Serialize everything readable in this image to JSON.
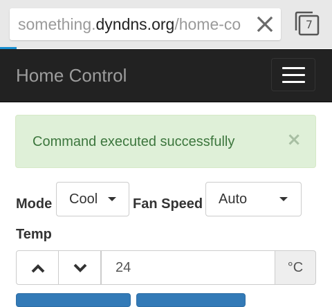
{
  "browser": {
    "url_prefix": "something.",
    "url_domain": "dyndns.org",
    "url_path": "/home-co",
    "clear_icon": "close-icon",
    "tabs_count": "7"
  },
  "navbar": {
    "brand": "Home Control",
    "menu_icon": "hamburger-icon"
  },
  "alert": {
    "message": "Command executed successfully",
    "close": "×"
  },
  "form": {
    "mode_label": "Mode",
    "mode_value": "Cool",
    "fan_label": "Fan Speed",
    "fan_value": "Auto",
    "temp_label": "Temp",
    "temp_value": "24",
    "temp_unit": "°C",
    "up_icon": "chevron-up-icon",
    "down_icon": "chevron-down-icon"
  },
  "colors": {
    "navbar_bg": "#222222",
    "alert_bg": "#dff0d8",
    "alert_text": "#3c763d",
    "accent": "#337ab7"
  }
}
